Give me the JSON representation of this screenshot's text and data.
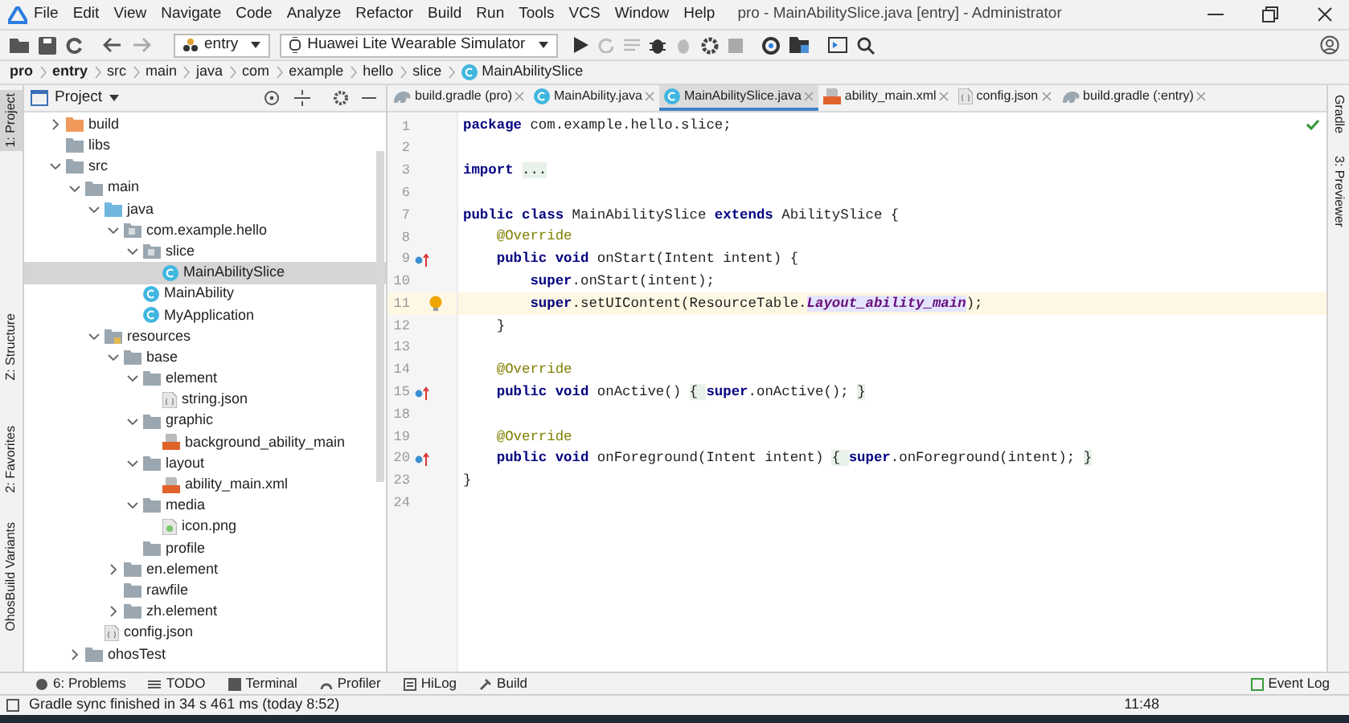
{
  "window": {
    "title": "pro - MainAbilitySlice.java [entry] - Administrator"
  },
  "menu": [
    "File",
    "Edit",
    "View",
    "Navigate",
    "Code",
    "Analyze",
    "Refactor",
    "Build",
    "Run",
    "Tools",
    "VCS",
    "Window",
    "Help"
  ],
  "toolbar": {
    "module": "entry",
    "device": "Huawei Lite Wearable Simulator"
  },
  "breadcrumb": [
    {
      "label": "pro",
      "bold": true
    },
    {
      "label": "entry",
      "bold": true
    },
    {
      "label": "src",
      "bold": false
    },
    {
      "label": "main",
      "bold": false
    },
    {
      "label": "java",
      "bold": false
    },
    {
      "label": "com",
      "bold": false
    },
    {
      "label": "example",
      "bold": false
    },
    {
      "label": "hello",
      "bold": false
    },
    {
      "label": "slice",
      "bold": false
    },
    {
      "label": "MainAbilitySlice",
      "bold": false,
      "kind": "class"
    }
  ],
  "left_stripe": [
    {
      "label": "1: Project",
      "selected": true
    },
    {
      "label": "Z: Structure",
      "selected": false
    },
    {
      "label": "2: Favorites",
      "selected": false
    },
    {
      "label": "OhosBuild Variants",
      "selected": false
    }
  ],
  "right_stripe": [
    {
      "label": "Gradle"
    },
    {
      "label": "3: Previewer"
    }
  ],
  "project": {
    "title": "Project",
    "tree": [
      {
        "label": "build",
        "kind": "build-folder",
        "expanded": false,
        "selected": false
      },
      {
        "label": "libs",
        "kind": "folder",
        "selected": false
      },
      {
        "label": "src",
        "kind": "folder",
        "expanded": true,
        "selected": false,
        "children": [
          {
            "label": "main",
            "kind": "folder",
            "expanded": true,
            "selected": false,
            "children": [
              {
                "label": "java",
                "kind": "source-folder",
                "expanded": true,
                "selected": false,
                "children": [
                  {
                    "label": "com.example.hello",
                    "kind": "package",
                    "expanded": true,
                    "selected": false,
                    "children": [
                      {
                        "label": "slice",
                        "kind": "package",
                        "expanded": true,
                        "selected": false,
                        "children": [
                          {
                            "label": "MainAbilitySlice",
                            "kind": "class",
                            "selected": true
                          }
                        ]
                      },
                      {
                        "label": "MainAbility",
                        "kind": "class",
                        "selected": false
                      },
                      {
                        "label": "MyApplication",
                        "kind": "class",
                        "selected": false
                      }
                    ]
                  }
                ]
              },
              {
                "label": "resources",
                "kind": "resources-folder",
                "expanded": true,
                "selected": false,
                "children": [
                  {
                    "label": "base",
                    "kind": "folder",
                    "expanded": true,
                    "selected": false,
                    "children": [
                      {
                        "label": "element",
                        "kind": "folder",
                        "expanded": true,
                        "selected": false,
                        "children": [
                          {
                            "label": "string.json",
                            "kind": "json-file",
                            "selected": false
                          }
                        ]
                      },
                      {
                        "label": "graphic",
                        "kind": "folder",
                        "expanded": true,
                        "selected": false,
                        "children": [
                          {
                            "label": "background_ability_main",
                            "kind": "xml-file",
                            "selected": false
                          }
                        ]
                      },
                      {
                        "label": "layout",
                        "kind": "folder",
                        "expanded": true,
                        "selected": false,
                        "children": [
                          {
                            "label": "ability_main.xml",
                            "kind": "xml-file",
                            "selected": false
                          }
                        ]
                      },
                      {
                        "label": "media",
                        "kind": "folder",
                        "expanded": true,
                        "selected": false,
                        "children": [
                          {
                            "label": "icon.png",
                            "kind": "image-file",
                            "selected": false
                          }
                        ]
                      },
                      {
                        "label": "profile",
                        "kind": "folder",
                        "selected": false
                      }
                    ]
                  },
                  {
                    "label": "en.element",
                    "kind": "folder",
                    "expanded": false,
                    "selected": false
                  },
                  {
                    "label": "rawfile",
                    "kind": "folder",
                    "selected": false
                  },
                  {
                    "label": "zh.element",
                    "kind": "folder",
                    "expanded": false,
                    "selected": false
                  }
                ]
              },
              {
                "label": "config.json",
                "kind": "json-file",
                "selected": false
              }
            ]
          },
          {
            "label": "ohosTest",
            "kind": "folder",
            "expanded": false,
            "selected": false
          }
        ]
      }
    ]
  },
  "tabs": [
    {
      "label": "build.gradle (pro)",
      "kind": "gradle",
      "selected": false
    },
    {
      "label": "MainAbility.java",
      "kind": "class",
      "selected": false
    },
    {
      "label": "MainAbilitySlice.java",
      "kind": "class",
      "selected": true
    },
    {
      "label": "ability_main.xml",
      "kind": "xml",
      "selected": false
    },
    {
      "label": "config.json",
      "kind": "json",
      "selected": false
    },
    {
      "label": "build.gradle (:entry)",
      "kind": "gradle",
      "selected": false
    }
  ],
  "editor": {
    "lines": [
      {
        "number": "1",
        "current": false,
        "tokens": [
          {
            "kind": "keyword",
            "text": "package"
          },
          {
            "kind": "plain",
            "text": " com.example.hello.slice;"
          }
        ]
      },
      {
        "number": "2",
        "current": false
      },
      {
        "number": "3",
        "current": false,
        "tokens": [
          {
            "kind": "keyword",
            "text": "import "
          },
          {
            "kind": "folded",
            "text": "..."
          }
        ]
      },
      {
        "number": "6",
        "current": false
      },
      {
        "number": "7",
        "current": false,
        "tokens": [
          {
            "kind": "keyword",
            "text": "public class"
          },
          {
            "kind": "plain",
            "text": " MainAbilitySlice "
          },
          {
            "kind": "keyword",
            "text": "extends"
          },
          {
            "kind": "plain",
            "text": " AbilitySlice {"
          }
        ]
      },
      {
        "number": "8",
        "current": false,
        "tokens": [
          {
            "kind": "annotation",
            "text": "    @Override"
          }
        ]
      },
      {
        "number": "9",
        "current": false,
        "gutter": {
          "kind": "override"
        },
        "tokens": [
          {
            "kind": "keyword",
            "text": "    public void"
          },
          {
            "kind": "plain",
            "text": " onStart(Intent intent) {"
          }
        ]
      },
      {
        "number": "10",
        "current": false,
        "tokens": [
          {
            "kind": "keyword",
            "text": "        super"
          },
          {
            "kind": "plain",
            "text": ".onStart(intent);"
          }
        ]
      },
      {
        "number": "11",
        "current": true,
        "gutter": {
          "kind": "bulb"
        },
        "tokens": [
          {
            "kind": "keyword",
            "text": "        super"
          },
          {
            "kind": "plain",
            "text": ".setUIContent(ResourceTable."
          },
          {
            "kind": "field",
            "text": "Layout_ability_main"
          },
          {
            "kind": "plain",
            "text": ");"
          }
        ]
      },
      {
        "number": "12",
        "current": false,
        "tokens": [
          {
            "kind": "plain",
            "text": "    }"
          }
        ]
      },
      {
        "number": "13",
        "current": false
      },
      {
        "number": "14",
        "current": false,
        "tokens": [
          {
            "kind": "annotation",
            "text": "    @Override"
          }
        ]
      },
      {
        "number": "15",
        "current": false,
        "gutter": {
          "kind": "override"
        },
        "tokens": [
          {
            "kind": "keyword",
            "text": "    public void"
          },
          {
            "kind": "plain",
            "text": " onActive() "
          },
          {
            "kind": "folded",
            "text": "{ "
          },
          {
            "kind": "keyword",
            "text": "super"
          },
          {
            "kind": "plain",
            "text": ".onActive(); "
          },
          {
            "kind": "folded",
            "text": "}"
          }
        ]
      },
      {
        "number": "18",
        "current": false
      },
      {
        "number": "19",
        "current": false,
        "tokens": [
          {
            "kind": "annotation",
            "text": "    @Override"
          }
        ]
      },
      {
        "number": "20",
        "current": false,
        "gutter": {
          "kind": "override"
        },
        "tokens": [
          {
            "kind": "keyword",
            "text": "    public void"
          },
          {
            "kind": "plain",
            "text": " onForeground(Intent intent) "
          },
          {
            "kind": "folded",
            "text": "{ "
          },
          {
            "kind": "keyword",
            "text": "super"
          },
          {
            "kind": "plain",
            "text": ".onForeground(intent); "
          },
          {
            "kind": "folded",
            "text": "}"
          }
        ]
      },
      {
        "number": "23",
        "current": false,
        "tokens": [
          {
            "kind": "plain",
            "text": "}"
          }
        ]
      },
      {
        "number": "24",
        "current": false
      }
    ]
  },
  "tool_windows": [
    {
      "label": "6: Problems",
      "kind": "problems"
    },
    {
      "label": "TODO",
      "kind": "todo"
    },
    {
      "label": "Terminal",
      "kind": "terminal"
    },
    {
      "label": "Profiler",
      "kind": "profiler"
    },
    {
      "label": "HiLog",
      "kind": "hilog"
    },
    {
      "label": "Build",
      "kind": "build"
    }
  ],
  "event_log": "Event Log",
  "status_bar": {
    "message": "Gradle sync finished in 34 s 461 ms (today 8:52)",
    "clock": "11:48"
  }
}
